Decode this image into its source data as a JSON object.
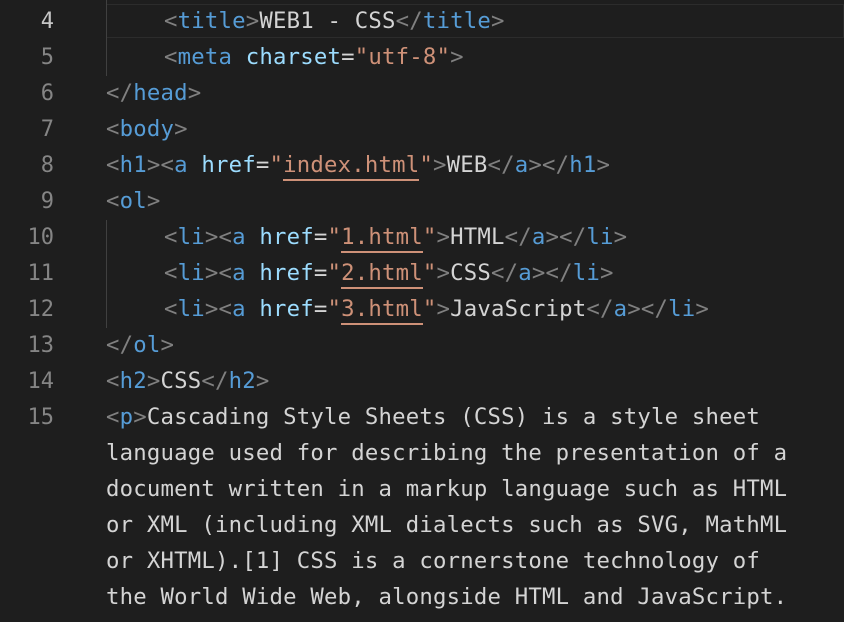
{
  "line_numbers": [
    "4",
    "5",
    "6",
    "7",
    "8",
    "9",
    "10",
    "11",
    "12",
    "13",
    "14",
    "15"
  ],
  "code": {
    "l4": {
      "title_tag": "title",
      "title_text": "WEB1 - CSS"
    },
    "l5": {
      "tag": "meta",
      "attr": "charset",
      "value": "utf-8"
    },
    "l6": {
      "tag": "head"
    },
    "l7": {
      "tag": "body"
    },
    "l8": {
      "h1": "h1",
      "a": "a",
      "attr": "href",
      "value": "index.html",
      "text": "WEB"
    },
    "l9": {
      "tag": "ol"
    },
    "items": [
      {
        "li": "li",
        "a": "a",
        "attr": "href",
        "value": "1.html",
        "text": "HTML"
      },
      {
        "li": "li",
        "a": "a",
        "attr": "href",
        "value": "2.html",
        "text": "CSS"
      },
      {
        "li": "li",
        "a": "a",
        "attr": "href",
        "value": "3.html",
        "text": "JavaScript"
      }
    ],
    "l13": {
      "tag": "ol"
    },
    "l14": {
      "tag": "h2",
      "text": "CSS"
    },
    "l15": {
      "tag": "p",
      "wrapped": [
        "Cascading Style Sheets (CSS) is a style sheet",
        "language used for describing the presentation of a",
        "document written in a markup language such as HTML",
        "or XML (including XML dialects such as SVG, MathML",
        "or XHTML).[1] CSS is a cornerstone technology of",
        "the World Wide Web, alongside HTML and JavaScript."
      ]
    }
  },
  "colors": {
    "background": "#1e1e1e",
    "punctuation": "#808080",
    "tag": "#569cd6",
    "attribute": "#9cdcfe",
    "string": "#ce9178",
    "text": "#d4d4d4",
    "line_number": "#858585",
    "active_line_number": "#c6c6c6"
  }
}
